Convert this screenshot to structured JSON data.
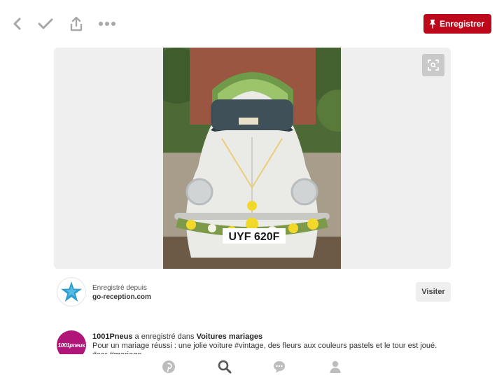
{
  "topbar": {
    "icons": [
      "back-icon",
      "check-icon",
      "share-icon",
      "more-icon"
    ],
    "save_label": "Enregistrer",
    "save_color": "#bd081c"
  },
  "pin": {
    "plate_text": "UYF 620F",
    "zoom_icon": "zoom-icon"
  },
  "source": {
    "saved_from_label": "Enregistré depuis",
    "domain": "go-reception.com",
    "visit_label": "Visiter"
  },
  "activity": {
    "avatar_text": "1001pneus",
    "user": "1001Pneus",
    "action": " a enregistré dans ",
    "board": "Voitures mariages",
    "description": "Pour un mariage réussi : une jolie voiture #vintage, des fleurs aux couleurs pastels et le tour est joué. #car #mariage"
  },
  "tabbar": {
    "icons": [
      "pinterest-icon",
      "search-icon",
      "messages-icon",
      "profile-icon"
    ]
  }
}
